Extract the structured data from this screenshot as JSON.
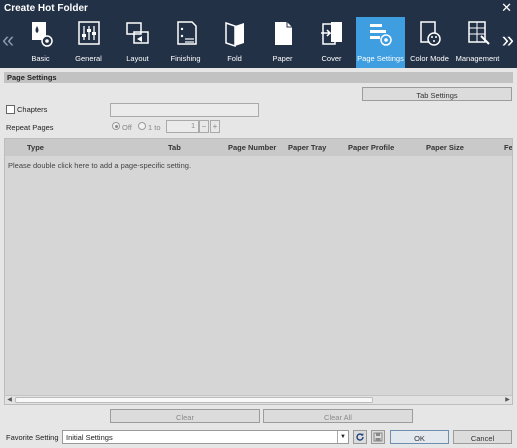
{
  "window": {
    "title": "Create Hot Folder"
  },
  "tabs": [
    {
      "label": "Basic",
      "icon": "basic-icon"
    },
    {
      "label": "General",
      "icon": "general-icon"
    },
    {
      "label": "Layout",
      "icon": "layout-icon"
    },
    {
      "label": "Finishing",
      "icon": "finishing-icon"
    },
    {
      "label": "Fold",
      "icon": "fold-icon"
    },
    {
      "label": "Paper",
      "icon": "paper-icon"
    },
    {
      "label": "Cover",
      "icon": "cover-icon"
    },
    {
      "label": "Page Settings",
      "icon": "page-settings-icon",
      "active": true
    },
    {
      "label": "Color Mode",
      "icon": "color-mode-icon"
    },
    {
      "label": "Management",
      "icon": "management-icon"
    }
  ],
  "section": {
    "title": "Page Settings",
    "tab_settings_label": "Tab Settings",
    "chapters_label": "Chapters",
    "chapters_checked": false,
    "chapters_value": "",
    "repeat_pages_label": "Repeat Pages",
    "repeat_off_label": "Off",
    "repeat_n_label": "1 to",
    "repeat_selected": "Off",
    "repeat_value": "1",
    "spin_minus": "−",
    "spin_plus": "+"
  },
  "table": {
    "columns": [
      "Type",
      "Tab",
      "Page Number",
      "Paper Tray",
      "Paper Profile",
      "Paper Size",
      "Fe"
    ],
    "empty_message": "Please double click here to add a page-specific setting."
  },
  "actions": {
    "clear_label": "Clear",
    "clear_all_label": "Clear All"
  },
  "footer": {
    "favorite_label": "Favorite Setting",
    "favorite_value": "Initial Settings",
    "ok_label": "OK",
    "cancel_label": "Cancel"
  },
  "colors": {
    "titlebar": "#233147",
    "active_tab": "#3e9ee0"
  }
}
